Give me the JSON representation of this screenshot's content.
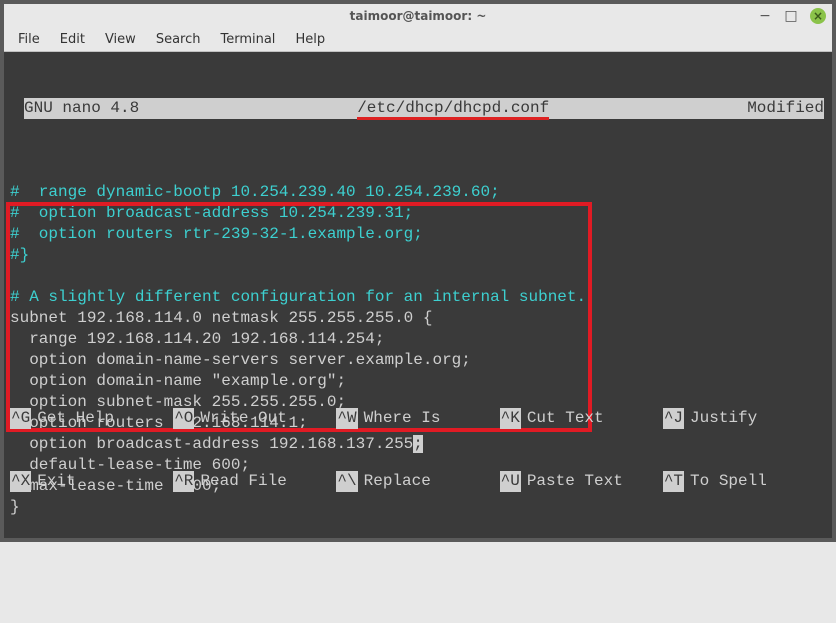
{
  "titlebar": {
    "title": "taimoor@taimoor: ~"
  },
  "menubar": {
    "items": [
      "File",
      "Edit",
      "View",
      "Search",
      "Terminal",
      "Help"
    ]
  },
  "nano": {
    "app": "GNU nano 4.8",
    "filename": "/etc/dhcp/dhcpd.conf",
    "status": "Modified"
  },
  "editor": {
    "lines": [
      {
        "class": "comment",
        "text": "#  range dynamic-bootp 10.254.239.40 10.254.239.60;"
      },
      {
        "class": "comment",
        "text": "#  option broadcast-address 10.254.239.31;"
      },
      {
        "class": "comment",
        "text": "#  option routers rtr-239-32-1.example.org;"
      },
      {
        "class": "comment",
        "text": "#}"
      },
      {
        "class": "normal",
        "text": " "
      },
      {
        "class": "comment",
        "text": "# A slightly different configuration for an internal subnet."
      },
      {
        "class": "normal",
        "text": "subnet 192.168.114.0 netmask 255.255.255.0 {"
      },
      {
        "class": "normal",
        "text": "  range 192.168.114.20 192.168.114.254;"
      },
      {
        "class": "normal",
        "text": "  option domain-name-servers server.example.org;"
      },
      {
        "class": "normal",
        "text": "  option domain-name \"example.org\";"
      },
      {
        "class": "normal",
        "text": "  option subnet-mask 255.255.255.0;"
      },
      {
        "class": "normal",
        "text": "  option routers 192.168.114.1;"
      },
      {
        "class": "normal",
        "text": "  option broadcast-address 192.168.137.255",
        "cursor": ";"
      },
      {
        "class": "normal",
        "text": "  default-lease-time 600;"
      },
      {
        "class": "normal",
        "text": "  max-lease-time 7200;"
      },
      {
        "class": "normal",
        "text": "}"
      }
    ]
  },
  "shortcuts": {
    "row1": [
      {
        "key": "^G",
        "label": "Get Help"
      },
      {
        "key": "^O",
        "label": "Write Out"
      },
      {
        "key": "^W",
        "label": "Where Is"
      },
      {
        "key": "^K",
        "label": "Cut Text"
      },
      {
        "key": "^J",
        "label": "Justify"
      }
    ],
    "row2": [
      {
        "key": "^X",
        "label": "Exit"
      },
      {
        "key": "^R",
        "label": "Read File"
      },
      {
        "key": "^\\",
        "label": "Replace"
      },
      {
        "key": "^U",
        "label": "Paste Text"
      },
      {
        "key": "^T",
        "label": "To Spell"
      }
    ]
  }
}
